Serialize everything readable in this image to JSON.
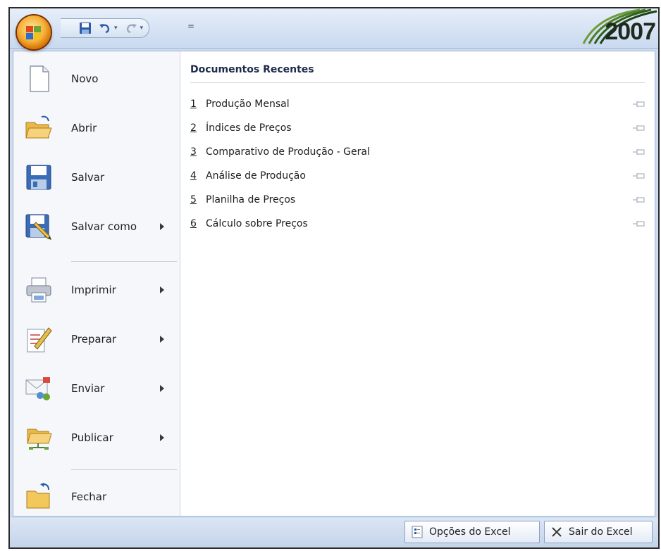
{
  "quick_access": {
    "customize_glyph": "="
  },
  "brand": {
    "year": "2007"
  },
  "menu_items": [
    {
      "label": "Novo",
      "has_submenu": false
    },
    {
      "label": "Abrir",
      "has_submenu": false
    },
    {
      "label": "Salvar",
      "has_submenu": false
    },
    {
      "label": "Salvar como",
      "has_submenu": true
    },
    {
      "label": "Imprimir",
      "has_submenu": true
    },
    {
      "label": "Preparar",
      "has_submenu": true
    },
    {
      "label": "Enviar",
      "has_submenu": true
    },
    {
      "label": "Publicar",
      "has_submenu": true
    },
    {
      "label": "Fechar",
      "has_submenu": false
    }
  ],
  "recent": {
    "title": "Documentos Recentes",
    "documents": [
      {
        "number": "1",
        "name": "Produção Mensal"
      },
      {
        "number": "2",
        "name": "Índices de Preços"
      },
      {
        "number": "3",
        "name": "Comparativo de Produção - Geral"
      },
      {
        "number": "4",
        "name": "Análise de Produção"
      },
      {
        "number": "5",
        "name": "Planilha de Preços"
      },
      {
        "number": "6",
        "name": "Cálculo sobre Preços"
      }
    ]
  },
  "footer": {
    "options_label": "Opções do Excel",
    "exit_label": "Sair do Excel"
  },
  "colors": {
    "frame": "#cfdcee",
    "orb": "#f6b23a",
    "menu_bg": "#f5f7fb"
  }
}
